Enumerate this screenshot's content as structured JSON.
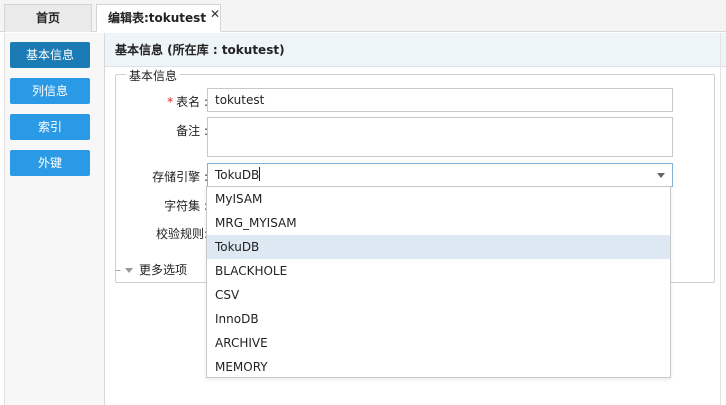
{
  "tabs": {
    "home": "首页",
    "edit": "编辑表:tokutest",
    "close": "✕"
  },
  "nav": {
    "basic_info": "基本信息",
    "columns": "列信息",
    "indexes": "索引",
    "foreign_keys": "外键"
  },
  "main": {
    "header": "基本信息 (所在库 : tokutest)",
    "section_legend": "基本信息",
    "required_mark": "*",
    "table_name_label": "表名 :",
    "table_name_value": "tokutest",
    "comment_label": "备注 :",
    "comment_value": "",
    "engine_label": "存储引擎 :",
    "engine_value": "TokuDB",
    "charset_label": "字符集 :",
    "collation_label": "校验规则:",
    "more_options": "更多选项"
  },
  "engine_options": [
    "MyISAM",
    "MRG_MYISAM",
    "TokuDB",
    "BLACKHOLE",
    "CSV",
    "InnoDB",
    "ARCHIVE",
    "MEMORY"
  ],
  "engine_selected": "TokuDB",
  "colors": {
    "nav_button": "#2b9ae6",
    "nav_button_active": "#1b7bb5",
    "header_bg": "#eef5f8",
    "option_highlight": "#dde8f3"
  }
}
